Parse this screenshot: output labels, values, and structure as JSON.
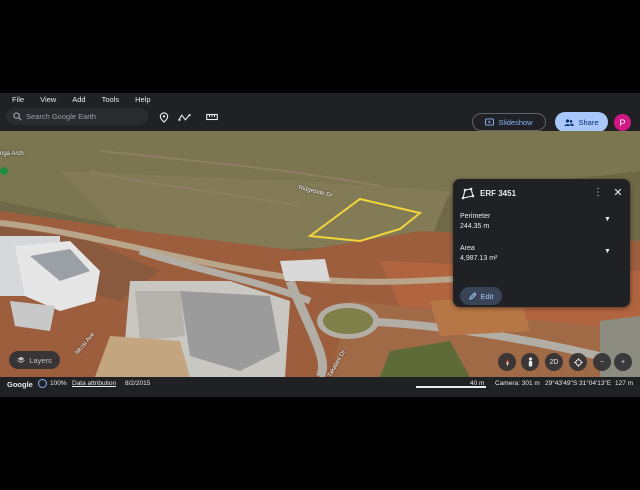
{
  "menu": [
    "File",
    "View",
    "Add",
    "Tools",
    "Help"
  ],
  "search": {
    "placeholder": "Search Google Earth"
  },
  "toolbar": {
    "slideshow_label": "Slideshow",
    "share_label": "Share",
    "avatar_letter": "P"
  },
  "panel": {
    "title": "ERF 3451",
    "perimeter": {
      "label": "Perimeter",
      "value": "244.35 m"
    },
    "area": {
      "label": "Area",
      "value": "4,987.13 m²"
    },
    "edit_label": "Edit"
  },
  "map_labels": {
    "road1": "Ridgeside Dr",
    "road2": "Nkosi Ave",
    "road3": "Takalani Dr",
    "place": "nga Arch"
  },
  "controls": {
    "layers_label": "Layers",
    "view_2d": "2D"
  },
  "status": {
    "logo": "Google",
    "zoom": "100%",
    "attribution": "Data attribution",
    "date": "8/2/2015",
    "scale": "40 m",
    "camera": "Camera: 301 m",
    "coords": "29°43'49\"S 31°04'13\"E",
    "elevation": "127 m"
  },
  "colors": {
    "polygon": "#f2d43b",
    "accent": "#8ab4f8",
    "share_bg": "#a8c7fa",
    "avatar_bg": "#d01884"
  }
}
